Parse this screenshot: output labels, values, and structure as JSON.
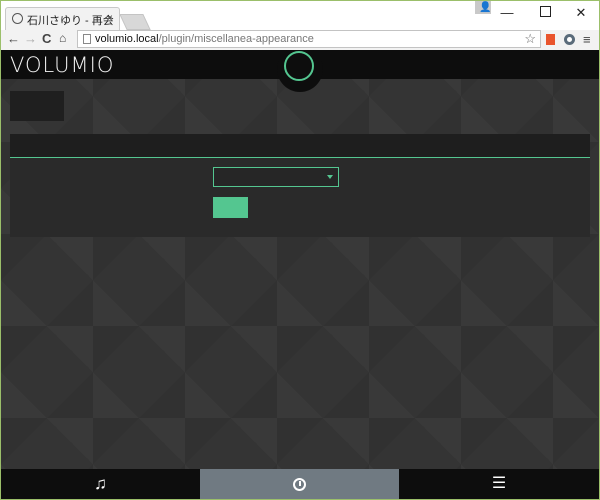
{
  "browser": {
    "tab_title": "石川さゆり - 再会",
    "tab_close": "×",
    "profile_glyph": "👤",
    "min": "—",
    "close": "✕",
    "nav_back": "←",
    "nav_forward": "→",
    "nav_reload": "C",
    "nav_home": "⌂",
    "url_host": "volumio.local",
    "url_path": "/plugin/miscellanea-appearance",
    "star": "☆",
    "menu": "≡"
  },
  "app": {
    "logo": "VOLUMIO",
    "panel_title": "",
    "select_value": "",
    "accent_color": "#54c690"
  },
  "bottom_nav": {
    "browse_icon": "♫",
    "queue_icon": "☰"
  }
}
